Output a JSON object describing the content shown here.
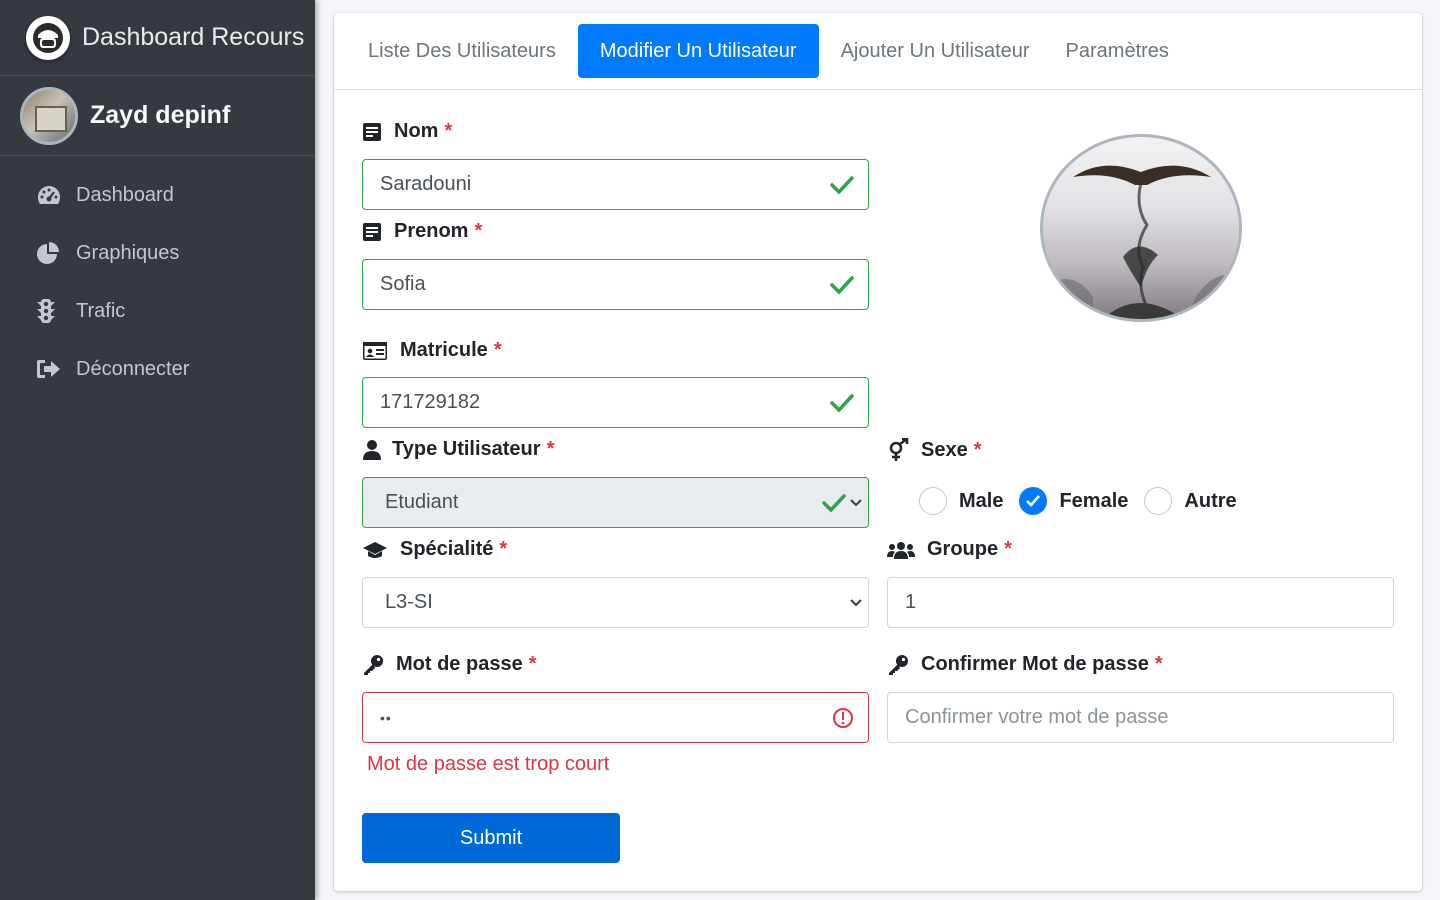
{
  "sidebar": {
    "brand": "Dashboard Recours",
    "user_name": "Zayd depinf",
    "items": [
      {
        "label": "Dashboard",
        "icon": "tachometer-icon"
      },
      {
        "label": "Graphiques",
        "icon": "pie-chart-icon"
      },
      {
        "label": "Trafic",
        "icon": "traffic-light-icon"
      },
      {
        "label": "Déconnecter",
        "icon": "sign-out-icon"
      }
    ]
  },
  "tabs": [
    {
      "label": "Liste Des Utilisateurs",
      "active": false
    },
    {
      "label": "Modifier Un Utilisateur",
      "active": true
    },
    {
      "label": "Ajouter Un Utilisateur",
      "active": false
    },
    {
      "label": "Paramètres",
      "active": false
    }
  ],
  "form": {
    "required_mark": "*",
    "nom": {
      "label": "Nom",
      "value": "Saradouni"
    },
    "prenom": {
      "label": "Prenom",
      "value": "Sofia"
    },
    "matricule": {
      "label": "Matricule",
      "value": "171729182"
    },
    "type": {
      "label": "Type Utilisateur",
      "value": "Etudiant"
    },
    "sexe": {
      "label": "Sexe",
      "options": [
        "Male",
        "Female",
        "Autre"
      ],
      "selected": "Female"
    },
    "specialite": {
      "label": "Spécialité",
      "value": "L3-SI"
    },
    "groupe": {
      "label": "Groupe",
      "value": "1"
    },
    "password": {
      "label": "Mot de passe",
      "value": "••",
      "error": "Mot de passe est trop court"
    },
    "confirm": {
      "label": "Confirmer Mot de passe",
      "placeholder": "Confirmer votre mot de passe"
    },
    "submit": "Submit"
  },
  "colors": {
    "primary": "#007bff",
    "valid": "#28a745",
    "invalid": "#dc3545",
    "sidebar_bg": "#343a40"
  }
}
